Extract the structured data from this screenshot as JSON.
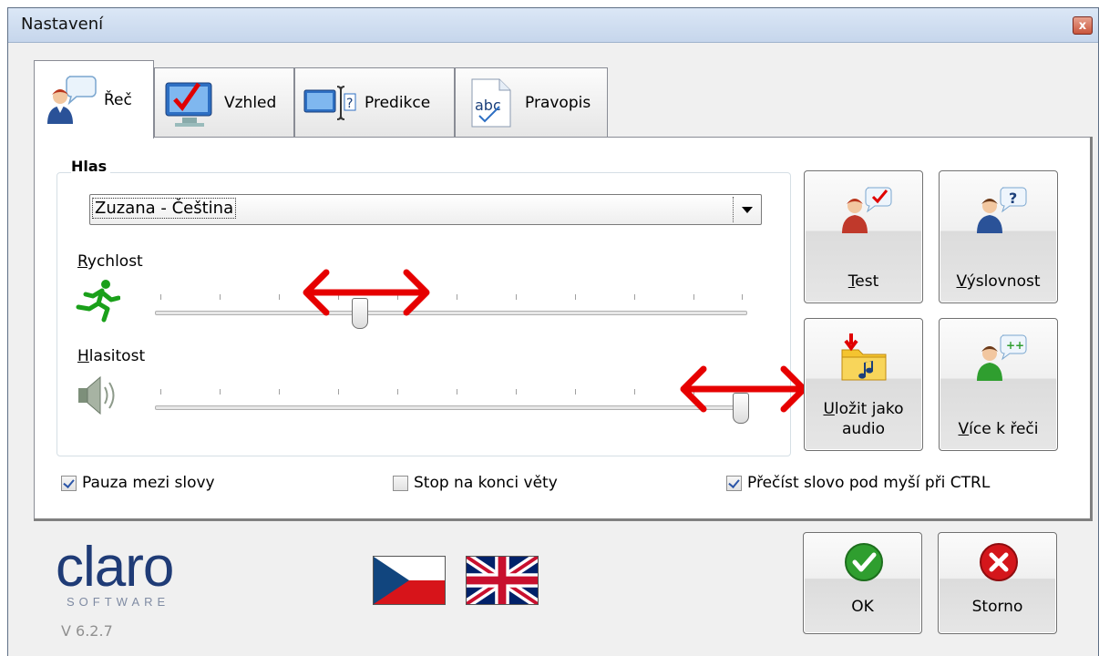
{
  "window": {
    "title": "Nastavení",
    "close_symbol": "x"
  },
  "tabs": [
    {
      "label": "Řeč",
      "icon": "speaker-person-icon",
      "active": true
    },
    {
      "label": "Vzhled",
      "icon": "monitor-check-icon",
      "active": false
    },
    {
      "label": "Predikce",
      "icon": "prediction-icon",
      "active": false
    },
    {
      "label": "Pravopis",
      "icon": "spelling-abc-icon",
      "active": false
    }
  ],
  "voice": {
    "group_title": "Hlas",
    "selected_voice": "Zuzana - Čeština",
    "speed": {
      "label_access": "R",
      "label_rest": "ychlost",
      "value_fraction": 0.35,
      "icon": "running-man-icon"
    },
    "volume": {
      "label_access": "H",
      "label_rest": "lasitost",
      "value_fraction": 1.0,
      "icon": "speaker-icon"
    }
  },
  "side_buttons": {
    "test": {
      "access": "T",
      "rest": "est",
      "icon": "person-check-icon"
    },
    "pronunciation": {
      "access": "V",
      "rest": "ýslovnost",
      "icon": "person-question-icon"
    },
    "save_audio": {
      "access": "U",
      "rest": "ložit jako",
      "line2": "audio",
      "icon": "folder-music-icon"
    },
    "more_speech": {
      "access": "V",
      "rest": "íce k řeči",
      "icon": "person-plus-icon"
    }
  },
  "checkboxes": [
    {
      "label": "Pauza mezi slovy",
      "checked": true
    },
    {
      "label": "Stop na konci věty",
      "checked": false
    },
    {
      "label": "Přečíst slovo pod myší při CTRL",
      "checked": true
    }
  ],
  "footer": {
    "logo_main": "claro",
    "logo_sub": "SOFTWARE",
    "version": "V 6.2.7",
    "ok_label": "OK",
    "cancel_label": "Storno",
    "flags": [
      "czech-flag-icon",
      "uk-flag-icon"
    ]
  },
  "colors": {
    "accent_red": "#e60000",
    "logo_blue": "#1f3b76",
    "ok_green": "#2f9e2f",
    "cancel_red": "#d4161b"
  }
}
